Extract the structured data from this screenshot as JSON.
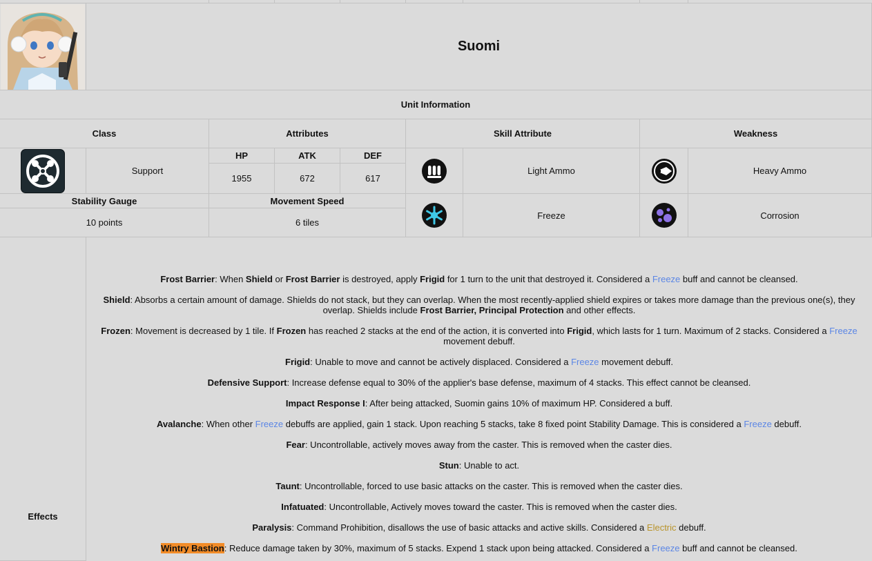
{
  "character": {
    "name": "Suomi",
    "portrait_icon": "character-portrait"
  },
  "unit_info": {
    "heading": "Unit Information"
  },
  "headers": {
    "class": "Class",
    "attributes": "Attributes",
    "skill_attribute": "Skill Attribute",
    "weakness": "Weakness"
  },
  "class": {
    "name": "Support",
    "icon": "support-class-icon"
  },
  "stats": {
    "hp_label": "HP",
    "atk_label": "ATK",
    "def_label": "DEF",
    "hp": "1955",
    "atk": "672",
    "def": "617"
  },
  "skill_attributes": [
    {
      "name": "Light Ammo",
      "icon": "light-ammo-icon"
    },
    {
      "name": "Freeze",
      "icon": "freeze-icon"
    }
  ],
  "weaknesses": [
    {
      "name": "Heavy Ammo",
      "icon": "heavy-ammo-icon"
    },
    {
      "name": "Corrosion",
      "icon": "corrosion-icon"
    }
  ],
  "stability": {
    "label": "Stability Gauge",
    "value": "10 points"
  },
  "movement": {
    "label": "Movement Speed",
    "value": "6 tiles"
  },
  "effects": {
    "label": "Effects",
    "items": [
      {
        "term": "Frost Barrier",
        "pre": ": When ",
        "b1": "Shield",
        "m1": " or ",
        "b2": "Frost Barrier",
        "m2": " is destroyed, apply ",
        "b3": "Frigid",
        "m3": " for 1 turn to the unit that destroyed it. Considered a ",
        "link": "Freeze",
        "post": " buff and cannot be cleansed."
      },
      {
        "term": "Shield",
        "text": ": Absorbs a certain amount of damage. Shields do not stack, but they can overlap. When the most recently-applied shield expires or takes more damage than the previous one(s), they overlap. Shields include ",
        "b1": "Frost Barrier, Principal Protection",
        "post": " and other effects."
      },
      {
        "term": "Frozen",
        "pre": ": Movement is decreased by 1 tile. If ",
        "b1": "Frozen",
        "m1": " has reached 2 stacks at the end of the action, it is converted into ",
        "b2": "Frigid",
        "m2": ", which lasts for 1 turn. Maximum of 2 stacks. Considered a ",
        "link": "Freeze",
        "post": " movement debuff."
      },
      {
        "term": "Frigid",
        "pre": ": Unable to move and cannot be actively displaced. Considered a ",
        "link": "Freeze",
        "post": " movement debuff."
      },
      {
        "term": "Defensive Support",
        "text": ": Increase defense equal to 30% of the applier's base defense, maximum of 4 stacks. This effect cannot be cleansed."
      },
      {
        "term": "Impact Response I",
        "text": ": After being attacked, Suomin gains 10% of maximum HP. Considered a buff."
      },
      {
        "term": "Avalanche",
        "pre": ": When other ",
        "link": "Freeze",
        "mid": " debuffs are applied, gain 1 stack. Upon reaching 5 stacks, take 8 fixed point Stability Damage. This is considered a ",
        "link2": "Freeze",
        "post": " debuff."
      },
      {
        "term": "Fear",
        "text": ": Uncontrollable, actively moves away from the caster. This is removed when the caster dies."
      },
      {
        "term": "Stun",
        "text": ": Unable to act."
      },
      {
        "term": "Taunt",
        "text": ": Uncontrollable, forced to use basic attacks on the caster. This is removed when the caster dies."
      },
      {
        "term": "Infatuated",
        "text": ": Uncontrollable, Actively moves toward the caster. This is removed when the caster dies."
      },
      {
        "term": "Paralysis",
        "pre": ": Command Prohibition, disallows the use of basic attacks and active skills. Considered a ",
        "link": "Electric",
        "post": " debuff."
      },
      {
        "term": "Wintry Bastion",
        "pre": ": Reduce damage taken by 30%, maximum of 5 stacks. Expend 1 stack upon being attacked. Considered a ",
        "link": "Freeze",
        "post": " buff and cannot be cleansed."
      }
    ]
  },
  "colors": {
    "link_blue": "#5b86e5",
    "electric_gold": "#b8932a",
    "highlight_orange": "#f28c28"
  }
}
